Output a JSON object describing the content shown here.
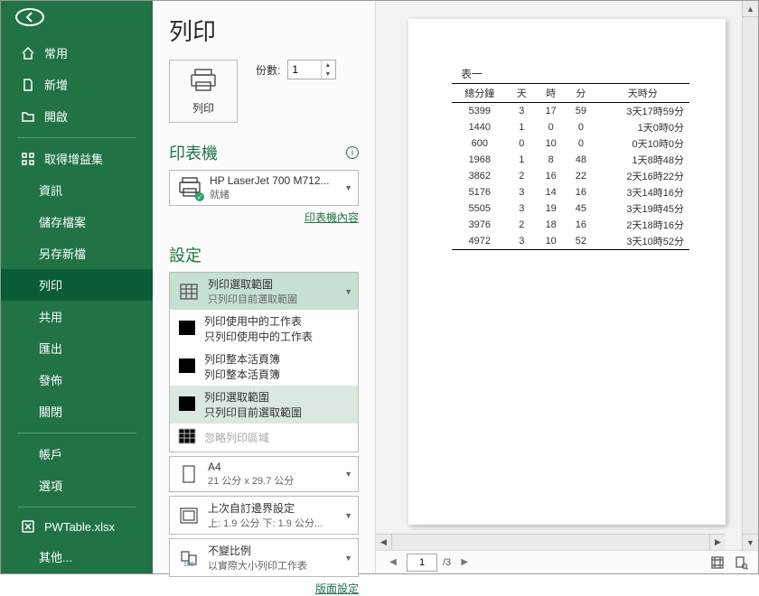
{
  "sidebar": {
    "items": [
      {
        "label": "常用",
        "icon": "home"
      },
      {
        "label": "新增",
        "icon": "doc"
      },
      {
        "label": "開啟",
        "icon": "folder"
      }
    ],
    "items2": [
      {
        "label": "取得增益集",
        "icon": "grid"
      },
      {
        "label": "資訊",
        "indent": true
      },
      {
        "label": "儲存檔案",
        "indent": true
      },
      {
        "label": "另存新檔",
        "indent": true
      },
      {
        "label": "列印",
        "indent": true,
        "selected": true
      },
      {
        "label": "共用",
        "indent": true
      },
      {
        "label": "匯出",
        "indent": true
      },
      {
        "label": "發佈",
        "indent": true
      },
      {
        "label": "關閉",
        "indent": true
      }
    ],
    "items3": [
      {
        "label": "帳戶",
        "indent": true
      },
      {
        "label": "選項",
        "indent": true
      }
    ],
    "file": {
      "label": "PWTable.xlsx",
      "icon": "excel"
    },
    "more": {
      "label": "其他..."
    }
  },
  "title": "列印",
  "print_button": "列印",
  "copies_label": "份數:",
  "copies_value": "1",
  "printer": {
    "section": "印表機",
    "name": "HP LaserJet 700 M712...",
    "status": "就緒",
    "props_link": "印表機內容"
  },
  "settings": {
    "section": "設定",
    "scope": {
      "t1": "列印選取範圍",
      "t2": "只列印目前選取範圍"
    },
    "scope_options": [
      {
        "t1": "列印使用中的工作表",
        "t2": "只列印使用中的工作表"
      },
      {
        "t1": "列印整本活頁簿",
        "t2": "列印整本活頁簿"
      },
      {
        "t1": "列印選取範圍",
        "t2": "只列印目前選取範圍",
        "hl": true
      },
      {
        "t1": "忽略列印區域",
        "t2": "",
        "disabled": true
      }
    ],
    "paper": {
      "t1": "A4",
      "t2": "21 公分 x 29.7 公分"
    },
    "margins": {
      "t1": "上次自訂邊界設定",
      "t2": "上: 1.9 公分 下: 1.9 公分..."
    },
    "scaling": {
      "t1": "不變比例",
      "t2": "以實際大小列印工作表"
    },
    "page_setup_link": "版面設定"
  },
  "preview": {
    "table_title": "表一",
    "headers": [
      "總分鐘",
      "天",
      "時",
      "分",
      "天時分"
    ],
    "rows": [
      [
        "5399",
        "3",
        "17",
        "59",
        "3天17時59分"
      ],
      [
        "1440",
        "1",
        "0",
        "0",
        "1天0時0分"
      ],
      [
        "600",
        "0",
        "10",
        "0",
        "0天10時0分"
      ],
      [
        "1968",
        "1",
        "8",
        "48",
        "1天8時48分"
      ],
      [
        "3862",
        "2",
        "16",
        "22",
        "2天16時22分"
      ],
      [
        "5176",
        "3",
        "14",
        "16",
        "3天14時16分"
      ],
      [
        "5505",
        "3",
        "19",
        "45",
        "3天19時45分"
      ],
      [
        "3976",
        "2",
        "18",
        "16",
        "2天18時16分"
      ],
      [
        "4972",
        "3",
        "10",
        "52",
        "3天10時52分"
      ]
    ],
    "page_current": "1",
    "page_total": "/3"
  }
}
